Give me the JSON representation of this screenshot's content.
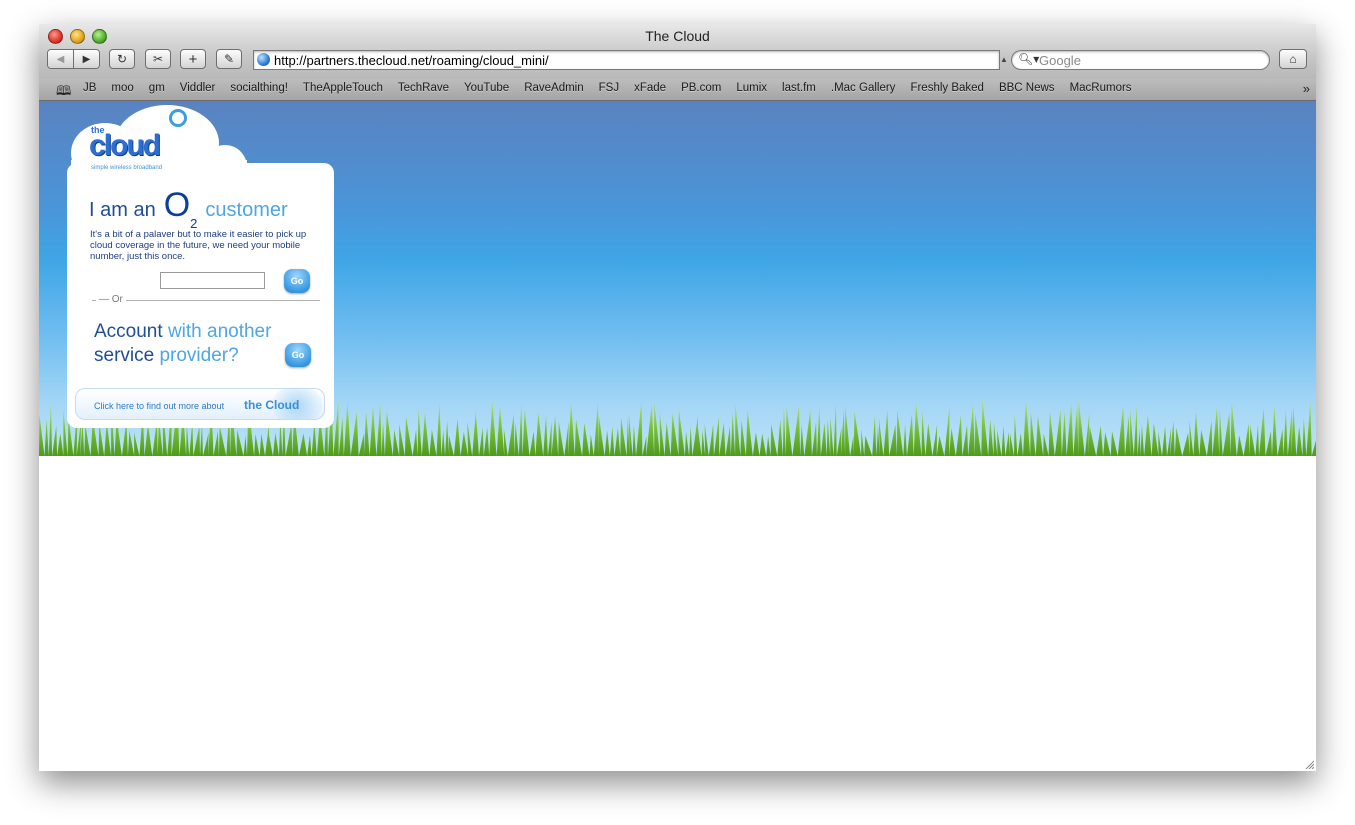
{
  "window": {
    "title": "The Cloud"
  },
  "toolbar": {
    "back_icon": "back-arrow-icon",
    "forward_icon": "forward-arrow-icon",
    "reload_icon": "reload-icon",
    "url": "http://partners.thecloud.net/roaming/cloud_mini/",
    "search_placeholder": "Google"
  },
  "bookmarks": [
    "JB",
    "moo",
    "gm",
    "Viddler",
    "socialthing!",
    "TheAppleTouch",
    "TechRave",
    "YouTube",
    "RaveAdmin",
    "FSJ",
    "xFade",
    "PB.com",
    "Lumix",
    "last.fm",
    ".Mac Gallery",
    "Freshly Baked",
    "BBC News",
    "MacRumors"
  ],
  "page": {
    "logo": {
      "the": "the",
      "word": "cloud",
      "tagline": "simple wireless broadband"
    },
    "o2_heading": {
      "lead": "I am an",
      "o2": "O",
      "o2_sub": "2",
      "tail": "customer"
    },
    "blurb": "It's a bit of a palaver but to make it easier to pick up cloud coverage in the future, we need your mobile number, just this once.",
    "mobile_value": "",
    "go_label": "Go",
    "or_label": "Or",
    "account": {
      "w1": "Account",
      "w2": "with",
      "w3": "another",
      "w4": "service",
      "w5": "provider?"
    },
    "findout": {
      "text": "Click here to find out more about",
      "brand": "the Cloud"
    }
  },
  "colors": {
    "sky_top": "#5a82c0",
    "sky_bottom": "#bde3f8",
    "brand_dark": "#1e4e98",
    "brand_light": "#4ea6e2"
  }
}
